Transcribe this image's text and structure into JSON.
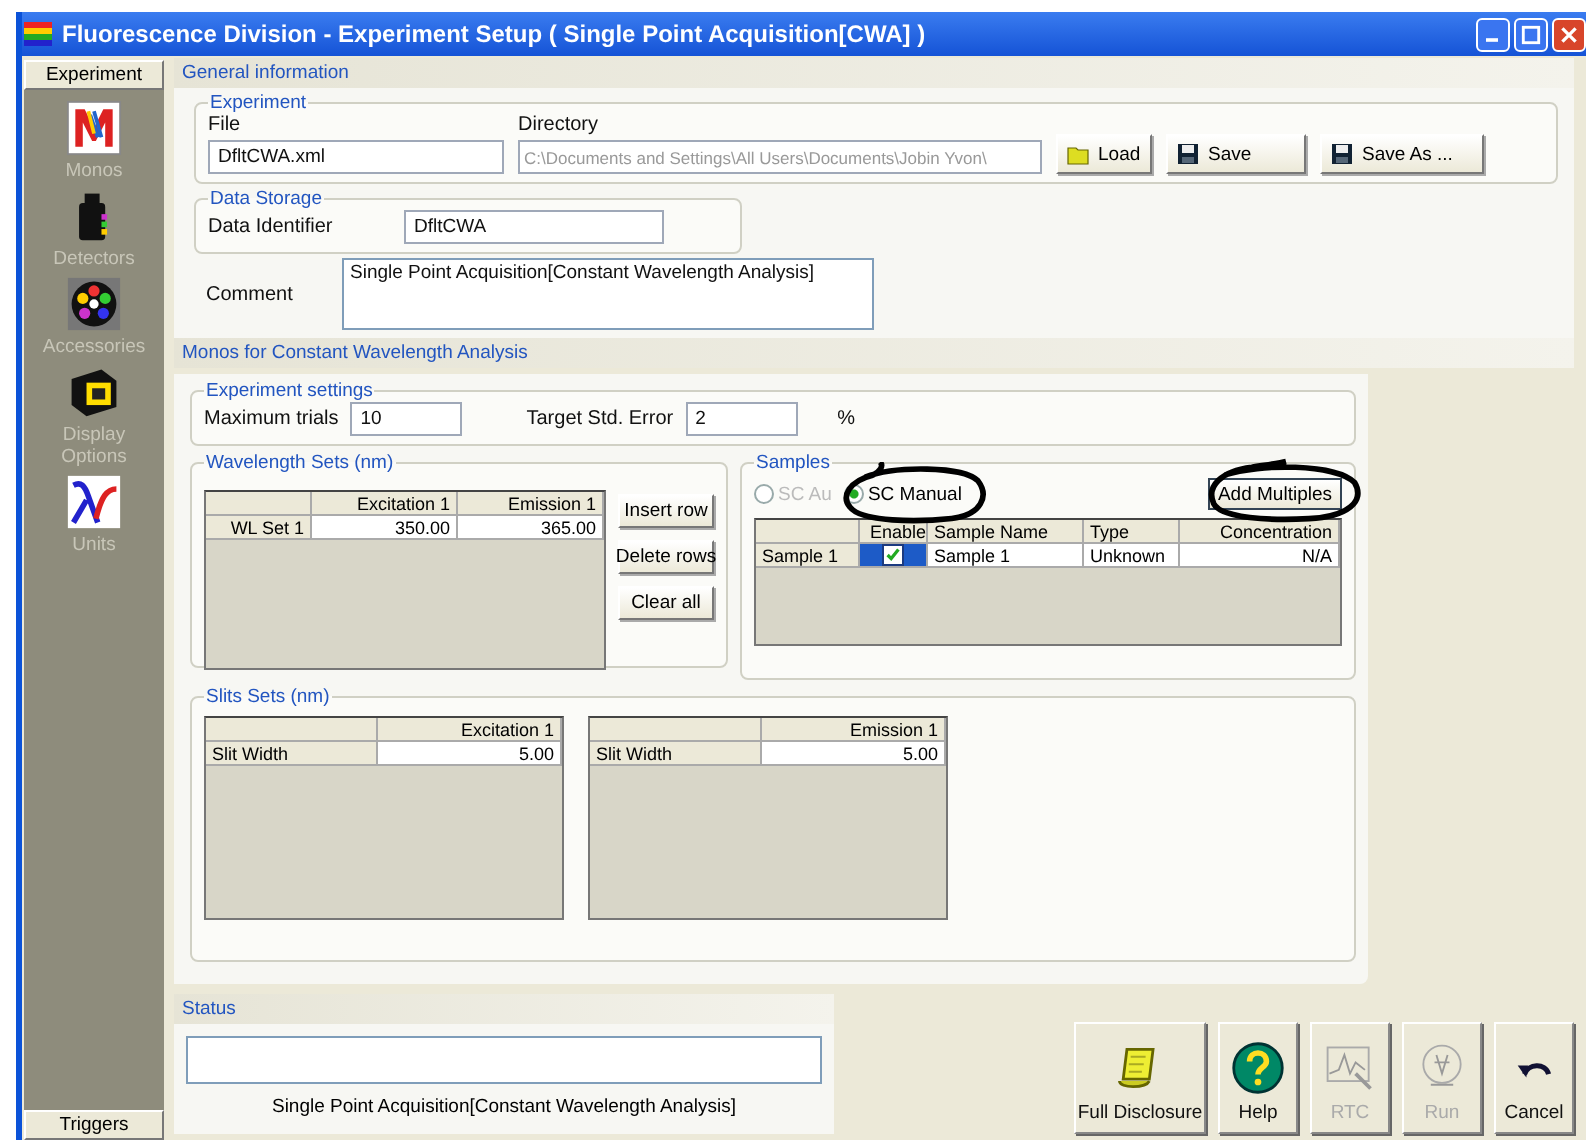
{
  "window": {
    "title": "Fluorescence Division - Experiment Setup ( Single Point Acquisition[CWA] )"
  },
  "sidebar": {
    "top_tab": "Experiment",
    "items": [
      {
        "label": "Monos"
      },
      {
        "label": "Detectors"
      },
      {
        "label": "Accessories"
      },
      {
        "label": "Display Options"
      },
      {
        "label": "Units"
      }
    ],
    "bottom_tab": "Triggers"
  },
  "general_information": {
    "heading": "General information",
    "experiment": {
      "legend": "Experiment",
      "file_label": "File",
      "file_value": "DfltCWA.xml",
      "directory_label": "Directory",
      "directory_value": "C:\\Documents and Settings\\All Users\\Documents\\Jobin Yvon\\",
      "directory_disabled": true,
      "buttons": [
        {
          "label": "Load"
        },
        {
          "label": "Save"
        },
        {
          "label": "Save As ..."
        }
      ]
    },
    "data_storage": {
      "legend": "Data Storage",
      "identifier_label": "Data Identifier",
      "identifier_value": "DfltCWA"
    },
    "comment_label": "Comment",
    "comment_value": "Single Point Acquisition[Constant Wavelength Analysis]"
  },
  "monos": {
    "heading": "Monos for Constant Wavelength Analysis",
    "experiment_settings": {
      "legend": "Experiment settings",
      "max_trials_label": "Maximum trials",
      "max_trials_value": "10",
      "target_error_label": "Target Std. Error",
      "target_error_value": "2",
      "target_error_unit": "%"
    },
    "wavelength_sets": {
      "legend": "Wavelength Sets (nm)",
      "columns": [
        "Excitation 1",
        "Emission 1"
      ],
      "rows": [
        {
          "header": "WL Set 1",
          "cells": [
            "350.00",
            "365.00"
          ]
        }
      ],
      "buttons": [
        "Insert row",
        "Delete rows",
        "Clear all"
      ]
    },
    "samples": {
      "legend": "Samples",
      "modes": [
        {
          "label": "SC Au",
          "selected": false,
          "disabled": true
        },
        {
          "label": "SC Manual",
          "selected": true,
          "disabled": false
        }
      ],
      "add_button": "Add Multiples",
      "columns": [
        "Enable",
        "Sample Name",
        "Type",
        "Concentration"
      ],
      "rows": [
        {
          "header": "Sample 1",
          "enabled": true,
          "name": "Sample 1",
          "type": "Unknown",
          "concentration": "N/A"
        }
      ]
    },
    "slits_sets": {
      "legend": "Slits Sets (nm)",
      "tables": [
        {
          "column": "Excitation 1",
          "row_header": "Slit Width",
          "value": "5.00"
        },
        {
          "column": "Emission 1",
          "row_header": "Slit Width",
          "value": "5.00"
        }
      ]
    }
  },
  "status": {
    "heading": "Status",
    "message": "Single Point Acquisition[Constant Wavelength Analysis]"
  },
  "actions": [
    {
      "label": "Full Disclosure",
      "disabled": false
    },
    {
      "label": "Help",
      "disabled": false
    },
    {
      "label": "RTC",
      "disabled": true
    },
    {
      "label": "Run",
      "disabled": true
    },
    {
      "label": "Cancel",
      "disabled": false
    }
  ]
}
